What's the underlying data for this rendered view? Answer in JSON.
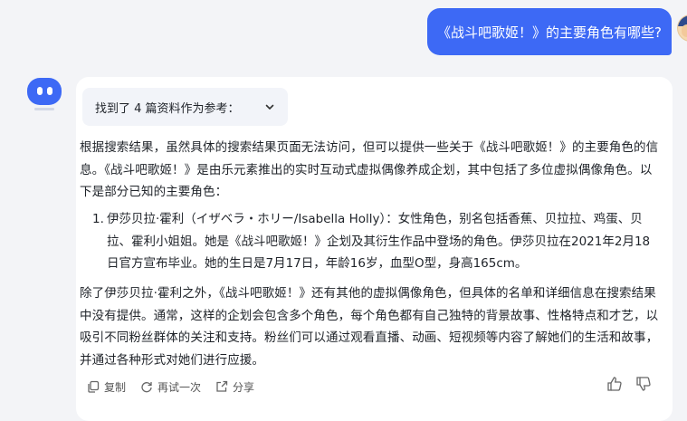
{
  "user_message": "《战斗吧歌姬！》的主要角色有哪些?",
  "references": {
    "label": "找到了 4 篇资料作为参考："
  },
  "answer": {
    "intro": "根据搜索结果，虽然具体的搜索结果页面无法访问，但可以提供一些关于《战斗吧歌姬！》的主要角色的信息。《战斗吧歌姬！》是由乐元素推出的实时互动式虚拟偶像养成企划，其中包括了多位虚拟偶像角色。以下是部分已知的主要角色：",
    "items": [
      {
        "num": "1.",
        "text": "伊莎贝拉·霍利（イザベラ・ホリー/Isabella Holly）：女性角色，别名包括香蕉、贝拉拉、鸡蛋、贝拉、霍利小姐姐。她是《战斗吧歌姬！》企划及其衍生作品中登场的角色。伊莎贝拉在2021年2月18日官方宣布毕业。她的生日是7月17日，年龄16岁，血型O型，身高165cm。"
      }
    ],
    "outro": "除了伊莎贝拉·霍利之外，《战斗吧歌姬！》还有其他的虚拟偶像角色，但具体的名单和详细信息在搜索结果中没有提供。通常，这样的企划会包含多个角色，每个角色都有自己独特的背景故事、性格特点和才艺，以吸引不同粉丝群体的关注和支持。粉丝们可以通过观看直播、动画、短视频等内容了解她们的生活和故事，并通过各种形式对她们进行应援。"
  },
  "actions": {
    "copy": "复制",
    "retry": "再试一次",
    "share": "分享"
  },
  "colors": {
    "accent": "#3d69f5",
    "card": "#ffffff",
    "background": "#f3f4f7"
  }
}
